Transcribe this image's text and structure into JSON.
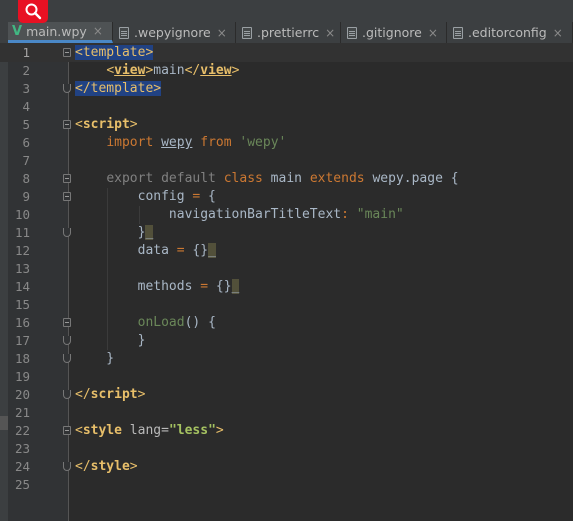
{
  "tabs": [
    {
      "label": "main.wpy",
      "icon": "vue-icon",
      "active": true
    },
    {
      "label": ".wepyignore",
      "icon": "file-icon",
      "active": false
    },
    {
      "label": ".prettierrc",
      "icon": "file-icon",
      "active": false
    },
    {
      "label": ".gitignore",
      "icon": "file-icon",
      "active": false
    },
    {
      "label": ".editorconfig",
      "icon": "file-icon",
      "active": false
    }
  ],
  "close_glyph": "×",
  "editor": {
    "current_line": 1,
    "lines": [
      {
        "n": "1",
        "parts": [
          {
            "t": "<template>",
            "c": "sel tag"
          }
        ]
      },
      {
        "n": "2",
        "parts": [
          {
            "t": "    "
          },
          {
            "t": "<",
            "c": "tag"
          },
          {
            "t": "view",
            "c": "tagb ul"
          },
          {
            "t": ">",
            "c": "tag"
          },
          {
            "t": "main"
          },
          {
            "t": "</",
            "c": "tag"
          },
          {
            "t": "view",
            "c": "tagb ul"
          },
          {
            "t": ">",
            "c": "tag"
          }
        ]
      },
      {
        "n": "3",
        "parts": [
          {
            "t": "</template>",
            "c": "sel tag"
          }
        ]
      },
      {
        "n": "4",
        "parts": []
      },
      {
        "n": "5",
        "parts": [
          {
            "t": "<",
            "c": "tag"
          },
          {
            "t": "script",
            "c": "tagb"
          },
          {
            "t": ">",
            "c": "tag"
          }
        ]
      },
      {
        "n": "6",
        "parts": [
          {
            "t": "    "
          },
          {
            "t": "import",
            "c": "kw"
          },
          {
            "t": " "
          },
          {
            "t": "wepy",
            "c": "ul"
          },
          {
            "t": " "
          },
          {
            "t": "from",
            "c": "kw"
          },
          {
            "t": " "
          },
          {
            "t": "'wepy'",
            "c": "str"
          }
        ]
      },
      {
        "n": "7",
        "parts": []
      },
      {
        "n": "8",
        "parts": [
          {
            "t": "    "
          },
          {
            "t": "export default",
            "c": "gray"
          },
          {
            "t": " "
          },
          {
            "t": "class",
            "c": "kw"
          },
          {
            "t": " main "
          },
          {
            "t": "extends",
            "c": "kw"
          },
          {
            "t": " wepy.page {"
          }
        ]
      },
      {
        "n": "9",
        "parts": [
          {
            "t": "        config "
          },
          {
            "t": "=",
            "c": "kw"
          },
          {
            "t": " {"
          }
        ]
      },
      {
        "n": "10",
        "parts": [
          {
            "t": "            navigationBarTitleText"
          },
          {
            "t": ":",
            "c": "kw"
          },
          {
            "t": " "
          },
          {
            "t": "\"main\"",
            "c": "str"
          }
        ]
      },
      {
        "n": "11",
        "parts": [
          {
            "t": "        }"
          },
          {
            "t": "_",
            "c": "mark"
          }
        ]
      },
      {
        "n": "12",
        "parts": [
          {
            "t": "        data "
          },
          {
            "t": "=",
            "c": "kw"
          },
          {
            "t": " {}"
          },
          {
            "t": "_",
            "c": "mark"
          }
        ]
      },
      {
        "n": "13",
        "parts": []
      },
      {
        "n": "14",
        "parts": [
          {
            "t": "        methods "
          },
          {
            "t": "=",
            "c": "kw"
          },
          {
            "t": " {}"
          },
          {
            "t": "_",
            "c": "mark"
          }
        ]
      },
      {
        "n": "15",
        "parts": []
      },
      {
        "n": "16",
        "parts": [
          {
            "t": "        "
          },
          {
            "t": "onLoad",
            "c": "str"
          },
          {
            "t": "() {"
          }
        ]
      },
      {
        "n": "17",
        "parts": [
          {
            "t": "        }"
          }
        ]
      },
      {
        "n": "18",
        "parts": [
          {
            "t": "    }"
          }
        ]
      },
      {
        "n": "19",
        "parts": []
      },
      {
        "n": "20",
        "parts": [
          {
            "t": "</",
            "c": "tag"
          },
          {
            "t": "script",
            "c": "tagb"
          },
          {
            "t": ">",
            "c": "tag"
          }
        ]
      },
      {
        "n": "21",
        "parts": []
      },
      {
        "n": "22",
        "parts": [
          {
            "t": "<",
            "c": "tag"
          },
          {
            "t": "style",
            "c": "tagb"
          },
          {
            "t": " "
          },
          {
            "t": "lang",
            "c": "attr"
          },
          {
            "t": "=",
            "c": "attr"
          },
          {
            "t": "\"less\"",
            "c": "strb"
          },
          {
            "t": ">",
            "c": "tag"
          }
        ]
      },
      {
        "n": "23",
        "parts": []
      },
      {
        "n": "24",
        "parts": [
          {
            "t": "</",
            "c": "tag"
          },
          {
            "t": "style",
            "c": "tagb"
          },
          {
            "t": ">",
            "c": "tag"
          }
        ]
      },
      {
        "n": "25",
        "parts": []
      }
    ],
    "folds": {
      "1": "open",
      "3": "end",
      "5": "open",
      "8": "open",
      "9": "open",
      "11": "end",
      "16": "open",
      "17": "end",
      "18": "end",
      "20": "end",
      "22": "open",
      "24": "end"
    }
  },
  "colors": {
    "accent": "#4a88c7",
    "search_button": "#e81123",
    "background": "#2b2b2b"
  }
}
